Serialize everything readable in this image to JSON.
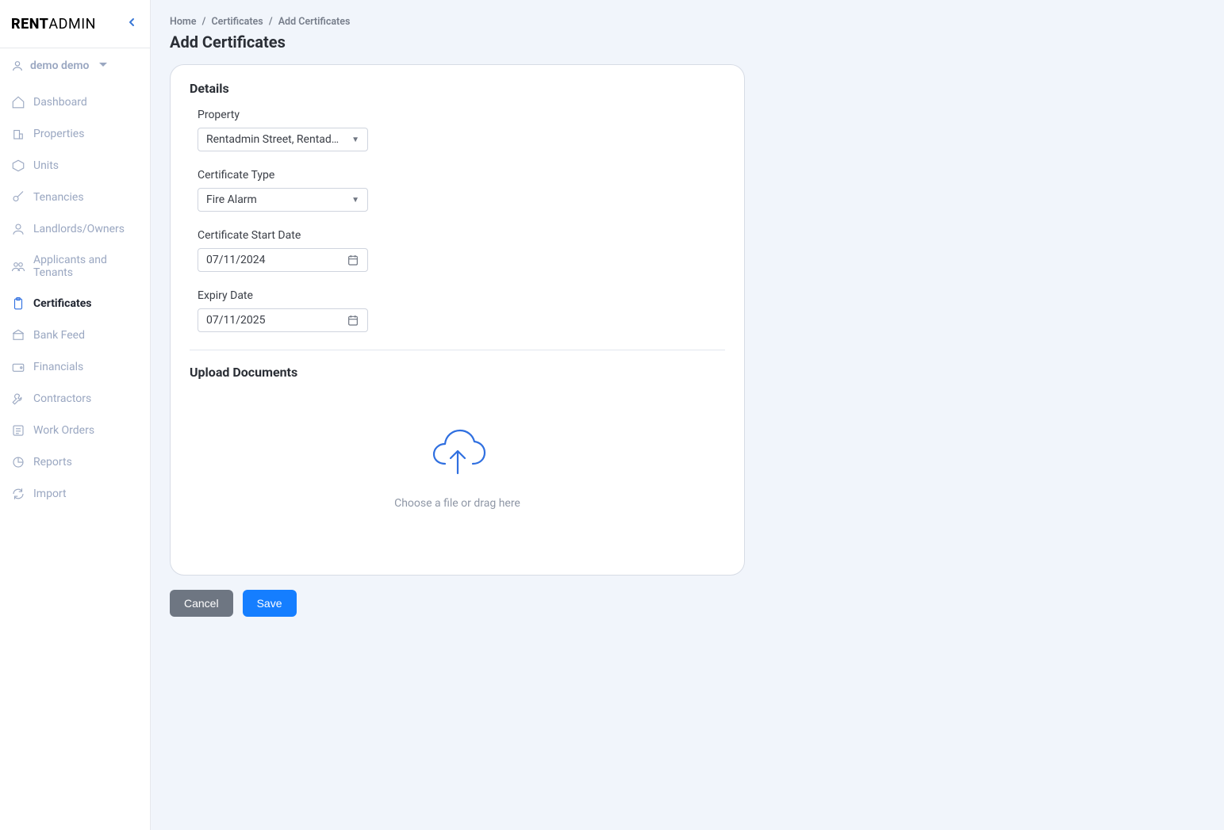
{
  "brand": {
    "bold": "RENT",
    "light": "ADMIN"
  },
  "user": {
    "name": "demo demo"
  },
  "nav": [
    {
      "key": "dashboard",
      "label": "Dashboard"
    },
    {
      "key": "properties",
      "label": "Properties"
    },
    {
      "key": "units",
      "label": "Units"
    },
    {
      "key": "tenancies",
      "label": "Tenancies"
    },
    {
      "key": "landlords",
      "label": "Landlords/Owners"
    },
    {
      "key": "applicants",
      "label": "Applicants and Tenants"
    },
    {
      "key": "certificates",
      "label": "Certificates",
      "active": true
    },
    {
      "key": "bankfeed",
      "label": "Bank Feed"
    },
    {
      "key": "financials",
      "label": "Financials"
    },
    {
      "key": "contractors",
      "label": "Contractors"
    },
    {
      "key": "workorders",
      "label": "Work Orders"
    },
    {
      "key": "reports",
      "label": "Reports"
    },
    {
      "key": "import",
      "label": "Import"
    }
  ],
  "breadcrumbs": [
    "Home",
    "Certificates",
    "Add Certificates"
  ],
  "page_title": "Add Certificates",
  "details": {
    "heading": "Details",
    "property_label": "Property",
    "property_value": "Rentadmin Street, Rentadmin,…",
    "cert_type_label": "Certificate Type",
    "cert_type_value": "Fire Alarm",
    "start_label": "Certificate Start Date",
    "start_value": "07/11/2024",
    "expiry_label": "Expiry Date",
    "expiry_value": "07/11/2025"
  },
  "upload": {
    "heading": "Upload Documents",
    "caption": "Choose a file or drag here"
  },
  "buttons": {
    "cancel": "Cancel",
    "save": "Save"
  }
}
